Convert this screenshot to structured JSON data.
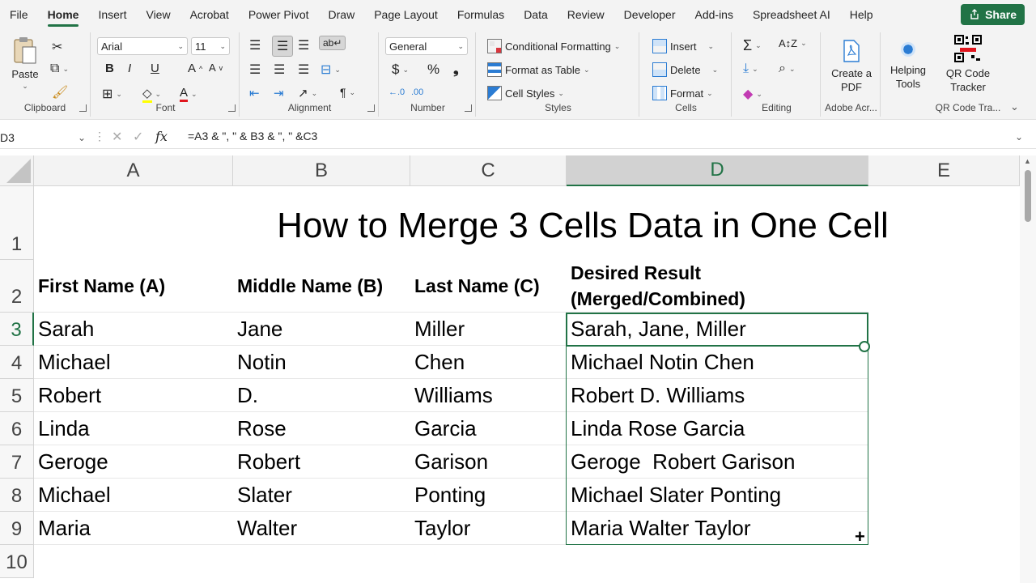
{
  "menu": {
    "items": [
      "File",
      "Home",
      "Insert",
      "View",
      "Acrobat",
      "Power Pivot",
      "Draw",
      "Page Layout",
      "Formulas",
      "Data",
      "Review",
      "Developer",
      "Add-ins",
      "Spreadsheet AI",
      "Help"
    ],
    "active": "Home",
    "share_label": "Share"
  },
  "ribbon": {
    "clipboard": {
      "paste_label": "Paste",
      "group_label": "Clipboard"
    },
    "font": {
      "font_name": "Arial",
      "font_size": "11",
      "group_label": "Font"
    },
    "alignment": {
      "group_label": "Alignment"
    },
    "number": {
      "format": "General",
      "group_label": "Number"
    },
    "styles": {
      "conditional_formatting": "Conditional Formatting",
      "format_as_table": "Format as Table",
      "cell_styles": "Cell Styles",
      "group_label": "Styles"
    },
    "cells": {
      "insert": "Insert",
      "delete": "Delete",
      "format": "Format",
      "group_label": "Cells"
    },
    "editing": {
      "group_label": "Editing"
    },
    "adobe": {
      "create_pdf": "Create a PDF",
      "group_label": "Adobe Acr..."
    },
    "helping": {
      "label": "Helping Tools"
    },
    "qr": {
      "label": "QR Code Tracker",
      "group_label": "QR Code Tra..."
    }
  },
  "formula_bar": {
    "name_box": "D3",
    "fx": "fx",
    "formula": "=A3 & \", \" & B3 & \", \" &C3"
  },
  "columns": [
    "A",
    "B",
    "C",
    "D",
    "E"
  ],
  "rows": [
    "1",
    "2",
    "3",
    "4",
    "5",
    "6",
    "7",
    "8",
    "9",
    "10"
  ],
  "sheet": {
    "title": "How to Merge 3 Cells Data in One Cell",
    "headers": {
      "a": "First Name (A)",
      "b": "Middle Name (B)",
      "c": "Last Name (C)",
      "d_line1": "Desired Result",
      "d_line2": "(Merged/Combined)"
    },
    "data": [
      [
        "Sarah",
        "Jane",
        "Miller",
        "Sarah, Jane, Miller"
      ],
      [
        "Michael",
        "Notin",
        "Chen",
        "Michael Notin Chen"
      ],
      [
        "Robert",
        "D.",
        "Williams",
        "Robert D. Williams"
      ],
      [
        "Linda",
        "Rose",
        "Garcia",
        "Linda Rose Garcia"
      ],
      [
        "Geroge",
        "Robert",
        "Garison",
        "Geroge  Robert Garison"
      ],
      [
        "Michael",
        "Slater",
        "Ponting",
        "Michael Slater Ponting"
      ],
      [
        "Maria",
        "Walter",
        "Taylor",
        "Maria Walter Taylor"
      ]
    ]
  },
  "colors": {
    "accent": "#217346"
  }
}
